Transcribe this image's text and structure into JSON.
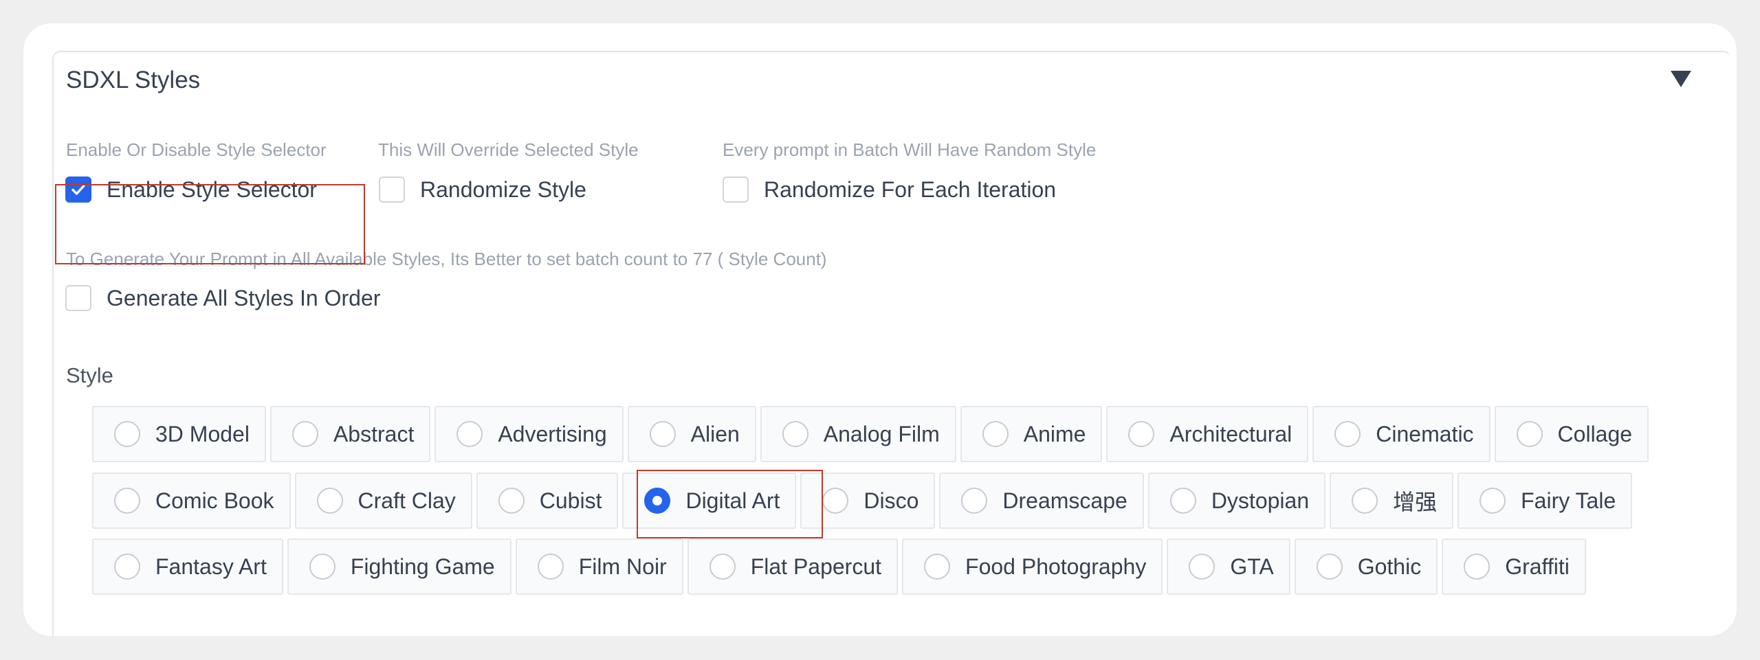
{
  "panel": {
    "title": "SDXL Styles",
    "toggle_icon": "triangle-down-icon"
  },
  "options": {
    "enable_info": "Enable Or Disable Style Selector",
    "enable_label": "Enable Style Selector",
    "enable_checked": true,
    "randomize_info": "This Will Override Selected Style",
    "randomize_label": "Randomize Style",
    "randomize_checked": false,
    "each_info": "Every prompt in Batch Will Have Random Style",
    "each_label": "Randomize For Each Iteration",
    "each_checked": false,
    "all_info": "To Generate Your Prompt in All Available Styles, Its Better to set batch count to 77 ( Style Count)",
    "all_label": "Generate All Styles In Order",
    "all_checked": false
  },
  "style": {
    "label": "Style",
    "selected": "Digital Art",
    "rows": [
      [
        "3D Model",
        "Abstract",
        "Advertising",
        "Alien",
        "Analog Film",
        "Anime",
        "Architectural",
        "Cinematic",
        "Collage"
      ],
      [
        "Comic Book",
        "Craft Clay",
        "Cubist",
        "Digital Art",
        "Disco",
        "Dreamscape",
        "Dystopian",
        "增强",
        "Fairy Tale"
      ],
      [
        "Fantasy Art",
        "Fighting Game",
        "Film Noir",
        "Flat Papercut",
        "Food Photography",
        "GTA",
        "Gothic",
        "Graffiti"
      ]
    ]
  },
  "colors": {
    "accent": "#2563eb",
    "highlight": "#c0392b"
  }
}
